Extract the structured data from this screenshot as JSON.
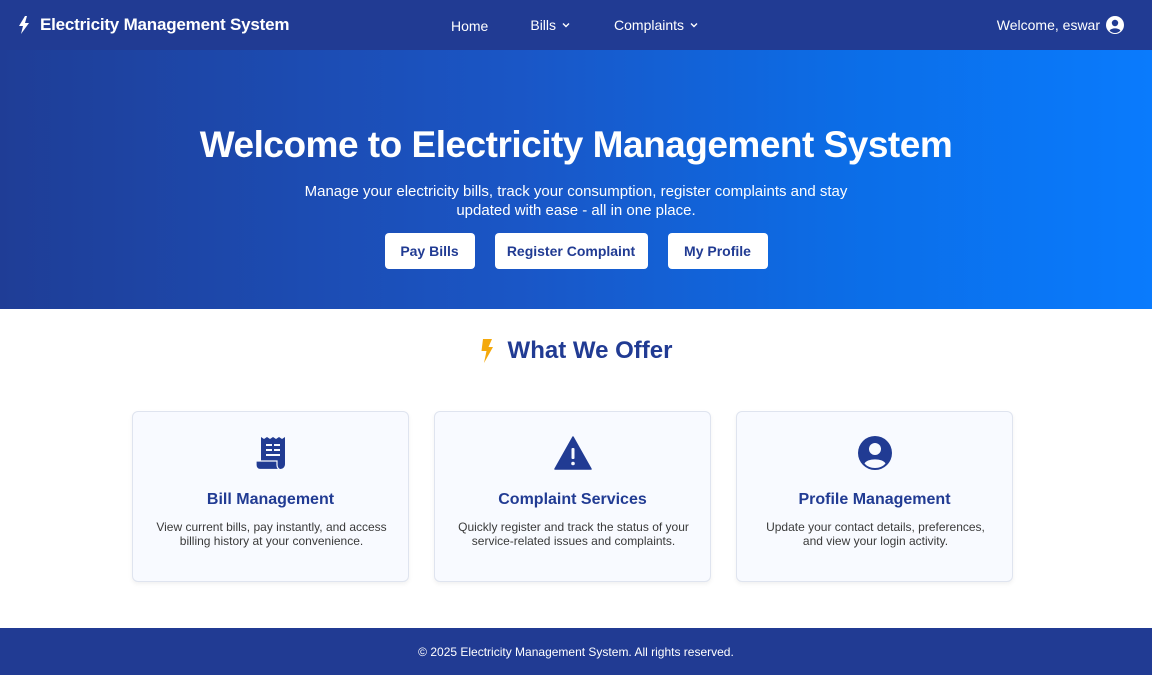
{
  "navbar": {
    "brand": "Electricity Management System",
    "links": {
      "home": "Home",
      "bills": "Bills",
      "complaints": "Complaints"
    },
    "welcome": "Welcome, eswar"
  },
  "hero": {
    "title": "Welcome to Electricity Management System",
    "subtitle": "Manage your electricity bills, track your consumption, register complaints and stay updated with ease - all in one place.",
    "buttons": {
      "pay_bills": "Pay Bills",
      "register_complaint": "Register Complaint",
      "my_profile": "My Profile"
    }
  },
  "offer": {
    "heading": "What We Offer",
    "cards": [
      {
        "icon": "receipt-icon",
        "title": "Bill Management",
        "description": "View current bills, pay instantly, and access billing history at your convenience."
      },
      {
        "icon": "warning-icon",
        "title": "Complaint Services",
        "description": "Quickly register and track the status of your service-related issues and complaints."
      },
      {
        "icon": "user-circle-icon",
        "title": "Profile Management",
        "description": "Update your contact details, preferences, and view your login activity."
      }
    ]
  },
  "footer": {
    "text": "© 2025 Electricity Management System. All rights reserved."
  },
  "colors": {
    "primary": "#213b93",
    "hero_gradient_start": "#1f3d96",
    "hero_gradient_end": "#0a7bfd",
    "accent_bolt": "#f4a90c",
    "card_background": "#f8faff"
  }
}
